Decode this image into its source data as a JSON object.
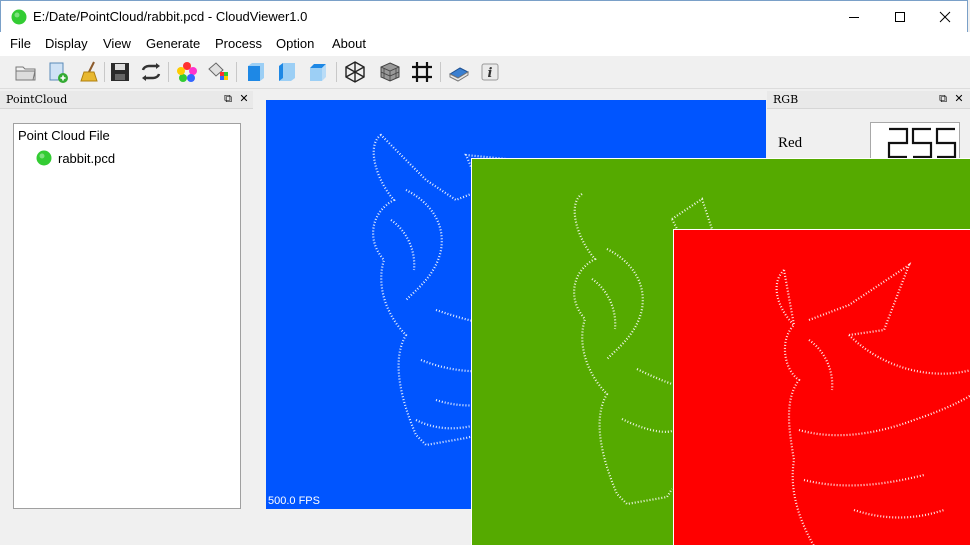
{
  "window": {
    "title": "E:/Date/PointCloud/rabbit.pcd - CloudViewer1.0",
    "controls": [
      "minimize",
      "maximize",
      "close"
    ]
  },
  "menu": [
    "File",
    "Display",
    "View",
    "Generate",
    "Process",
    "Option",
    "About"
  ],
  "toolbar": {
    "buttons": [
      "open-folder-icon",
      "add-file-icon",
      "clear-broom-icon",
      "save-icon",
      "convert-icon",
      "color-palette-icon",
      "paint-bucket-icon",
      "view-front-icon",
      "view-left-icon",
      "view-top-icon",
      "mesh-icon",
      "cube-grid-icon",
      "frame-icon",
      "book-icon",
      "info-icon"
    ]
  },
  "pointcloud_dock": {
    "title": "PointCloud",
    "tree_root": "Point Cloud File",
    "tree_items": [
      "rabbit.pcd"
    ]
  },
  "viewers": [
    {
      "background": "#0055ff",
      "fps": "500.0 FPS"
    },
    {
      "background": "#55aa00"
    },
    {
      "background": "#ff0000"
    }
  ],
  "rgb_dock": {
    "title": "RGB",
    "red_label": "Red",
    "red_value": "255"
  },
  "colors": {
    "app_icon": "#33cc33",
    "points": "#ffffff"
  }
}
